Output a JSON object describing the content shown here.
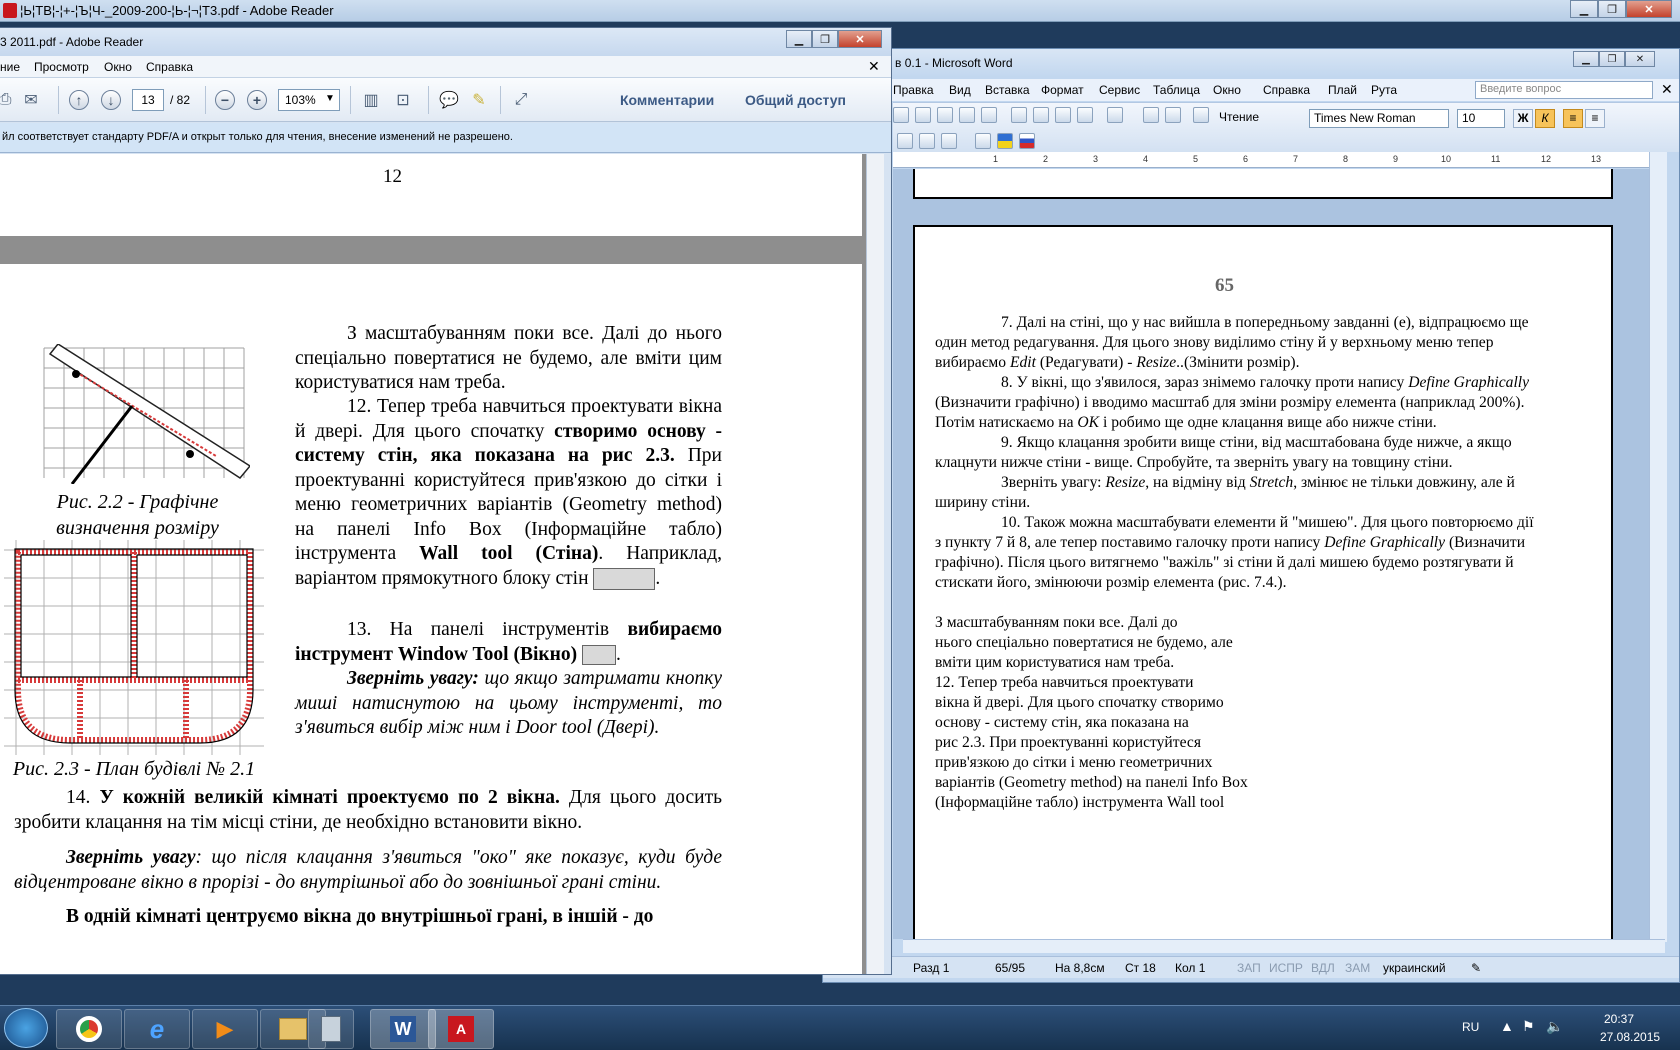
{
  "background_window": {
    "title": "¦Ь¦ТВ¦-¦+-¦Ъ¦Ч-_2009-200-¦Ь-¦¬¦Т3.pdf - Adobe Reader"
  },
  "word": {
    "title": "в 0.1 - Microsoft Word",
    "menu": [
      "Правка",
      "Вид",
      "Вставка",
      "Формат",
      "Сервис",
      "Таблица",
      "Окно",
      "Справка",
      "Плай",
      "Рута"
    ],
    "ask_placeholder": "Введите вопрос",
    "reading_label": "Чтение",
    "font_name": "Times New Roman",
    "font_size": "10",
    "bold_label": "Ж",
    "italic_label": "К",
    "ruler_numbers": [
      "1",
      "2",
      "3",
      "4",
      "5",
      "6",
      "7",
      "8",
      "9",
      "10",
      "11",
      "12",
      "13"
    ],
    "page_number": "65",
    "paragraphs": [
      {
        "indent": true,
        "parts": [
          {
            "t": "7. Далі на стіні, що у нас вийшла в попередньому завданні (е), відпрацюємо ще один метод редагування. Для цього знову виділимо стіну й у верхньому меню тепер вибираємо "
          },
          {
            "t": "Edit",
            "i": true
          },
          {
            "t": " (Редагувати) - "
          },
          {
            "t": "Resize",
            "i": true
          },
          {
            "t": "..(Змінити розмір)."
          }
        ]
      },
      {
        "indent": true,
        "parts": [
          {
            "t": "8. У вікні, що з'явилося, зараз знімемо галочку проти напису "
          },
          {
            "t": "Define Graphically",
            "i": true
          },
          {
            "t": " (Визначити графічно) і вводимо масштаб для зміни розміру елемента (наприклад 200%). Потім натискаємо на "
          },
          {
            "t": "OK",
            "i": true
          },
          {
            "t": " і робимо ще одне клацання вище або нижче стіни."
          }
        ]
      },
      {
        "indent": true,
        "parts": [
          {
            "t": "9. Якщо клацання зробити вище стіни, від масштабована буде нижче, а якщо клацнути нижче стіни - вище. Спробуйте, та зверніть увагу на товщину стіни."
          }
        ]
      },
      {
        "indent": true,
        "parts": [
          {
            "t": "Зверніть увагу: "
          },
          {
            "t": "Resize",
            "i": true
          },
          {
            "t": ", на відміну від "
          },
          {
            "t": "Stretch",
            "i": true
          },
          {
            "t": ", змінює не тільки довжину, але й ширину стіни."
          }
        ]
      },
      {
        "indent": true,
        "parts": [
          {
            "t": "10. Також можна масштабувати елементи й \"мишею\". Для цього повторюємо дії з пункту 7 й 8, але тепер поставимо галочку проти напису "
          },
          {
            "t": "Define Graphically",
            "i": true
          },
          {
            "t": " (Визначити графічно). Після цього витягнемо \"важіль\" зі стіни й далі мишею будемо розтягувати й стискати його, змінюючи розмір елемента (рис. 7.4.)."
          }
        ]
      }
    ],
    "pasted_lines": [
      "З масштабуванням поки все. Далі до",
      "нього спеціально повертатися не будемо, але",
      "вміти цим користуватися нам треба.",
      "12. Тепер треба навчиться проектувати",
      "вікна й двері. Для цього спочатку створимо",
      "основу - систему стін, яка показана на",
      "рис 2.3. При проектуванні користуйтеся",
      "прив'язкою до сітки і меню геометричних",
      "варіантів (Geometry method) на панелі Info Box",
      "(Інформаційне табло) інструмента Wall tool"
    ],
    "status": {
      "section": "Разд 1",
      "pages": "65/95",
      "at": "На 8,8см",
      "line": "Ст 18",
      "col": "Кол 1",
      "rec": "ЗАП",
      "trk": "ИСПР",
      "ext": "ВДЛ",
      "ovr": "ЗАМ",
      "lang": "украинский"
    }
  },
  "reader": {
    "title": "3 2011.pdf - Adobe Reader",
    "menu": [
      "ние",
      "Просмотр",
      "Окно",
      "Справка"
    ],
    "page_current": "13",
    "page_total": "/ 82",
    "zoom": "103%",
    "comments_link": "Комментарии",
    "share_link": "Общий доступ",
    "notice": "йл соответствует стандарту PDF/A и открыт только для чтения, внесение изменений не разрешено.",
    "page_a_number": "12",
    "pdf": {
      "p1": "З масштабуванням поки все. Далі до нього спеціально повертатися не будемо, але вміти цим користуватися нам треба.",
      "p2_a": "12. Тепер треба навчиться проектувати вікна й двері. Для цього спочатку ",
      "p2_b": "створимо основу - систему стін, яка показана на рис 2.3.",
      "p2_c": " При проектуванні користуйтеся прив'язкою до сітки і меню геометричних варіантів (Geometry method) на панелі Info Box (Інформаційне табло) інструмента ",
      "p2_d": "Wall tool (Стіна)",
      "p2_e": ". Наприклад, варіантом прямокутного блоку стін",
      "p3_a": "13. На панелі інструментів ",
      "p3_b": "вибираємо інструмент Window Tool (Вікно)",
      "p4_a": "Зверніть увагу:",
      "p4_b": " що якщо затримати кнопку миші натиснутою на цьому інструменті, то з'явиться вибір між ним і Door tool (Двері).",
      "cap1_line1": "Рис. 2.2 - Графічне",
      "cap1_line2": "визначення розміру",
      "cap2": "Рис. 2.3 - План будівлі № 2.1",
      "p5_a": "14. ",
      "p5_b": "У кожній великій кімнаті проектуємо по 2 вікна.",
      "p5_c": " Для цього досить зробити клацання на тім місці стіни, де необхідно встановити вікно.",
      "p6_a": "Зверніть увагу",
      "p6_b": ": що після клацання з'явиться \"око\" яке показує, куди буде відцентроване вікно в прорізі - до внутрішньої або до зовнішньої грані стіни.",
      "p7": "В одній кімнаті центруємо вікна до внутрішньої грані, в іншій - до"
    }
  },
  "taskbar": {
    "lang": "RU",
    "time": "20:37",
    "date": "27.08.2015"
  }
}
